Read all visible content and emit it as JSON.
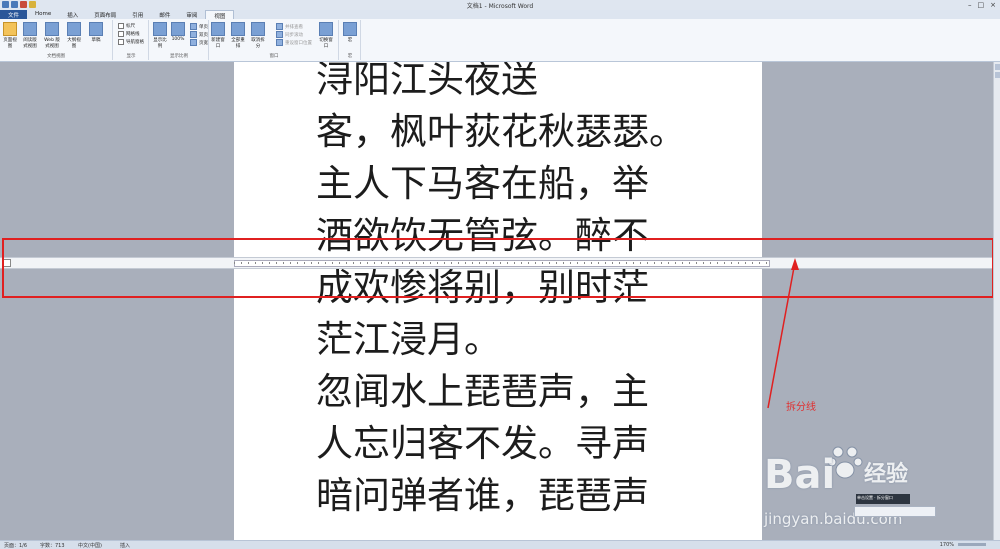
{
  "window": {
    "title": "文档1 - Microsoft Word"
  },
  "tabs": [
    "文件",
    "Home",
    "插入",
    "页面布局",
    "引用",
    "邮件",
    "审阅",
    "视图"
  ],
  "ribbon": {
    "doc_views": {
      "label": "文档视图",
      "buttons": [
        "页面视图",
        "阅读版式视图",
        "Web 版式视图",
        "大纲视图",
        "草稿"
      ]
    },
    "show": {
      "label": "显示",
      "checks": [
        "标尺",
        "网格线",
        "导航窗格"
      ]
    },
    "zoom": {
      "label": "显示比例",
      "buttons": [
        "显示比例",
        "100%"
      ],
      "small": [
        "单页",
        "双页",
        "页宽"
      ]
    },
    "window": {
      "label": "窗口",
      "buttons": [
        "新建窗口",
        "全部重排",
        "取消拆分"
      ],
      "small": [
        "并排查看",
        "同步滚动",
        "重设窗口位置"
      ],
      "switch": "切换窗口"
    },
    "macro": {
      "label": "宏",
      "button": "宏"
    }
  },
  "document": {
    "lines": [
      "浔阳江头夜送",
      "客，枫叶荻花秋瑟瑟。",
      "主人下马客在船，举",
      "酒欲饮无管弦。醉不",
      "成欢惨将别，别时茫",
      "茫江浸月。",
      "忽闻水上琵琶声，主",
      "人忘归客不发。寻声",
      "暗问弹者谁，琵琶声"
    ]
  },
  "annotation": {
    "label": "拆分线",
    "color": "#e02020"
  },
  "status": {
    "page": "页面：1/6",
    "words": "字数：713",
    "language": "中文(中国)",
    "mode": "插入",
    "zoom": "170%"
  },
  "watermark": {
    "brand": "Bai",
    "brand2": "经验",
    "url": "jingyan.baidu.com"
  },
  "popup": {
    "text": "单击设置 · 拆分窗口"
  }
}
